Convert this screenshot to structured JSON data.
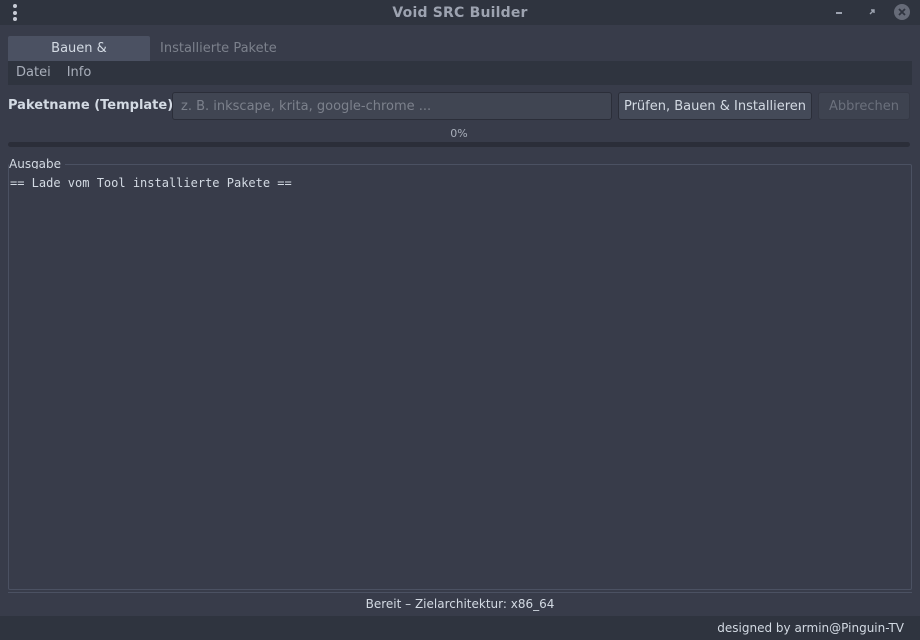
{
  "window": {
    "title": "Void SRC Builder"
  },
  "tabs": [
    {
      "label": "Bauen & Installieren",
      "active": true
    },
    {
      "label": "Installierte Pakete",
      "active": false
    }
  ],
  "menubar": {
    "file": "Datei",
    "info": "Info"
  },
  "form": {
    "label": "Paketname (Template):",
    "input_value": "",
    "input_placeholder": "z. B. inkscape, krita, google-chrome ...",
    "build_button": "Prüfen, Bauen & Installieren",
    "cancel_button": "Abbrechen"
  },
  "progress": {
    "label": "0%",
    "value": 0
  },
  "output": {
    "legend": "Ausgabe",
    "text": "== Lade vom Tool installierte Pakete =="
  },
  "status": {
    "text": "Bereit – Zielarchitektur: x86_64"
  },
  "footer": {
    "credit": "designed by armin@Pinguin-TV"
  },
  "colors": {
    "background": "#383c4a",
    "titlebar": "#2f343f",
    "text": "#d3dae3",
    "accent": "#5294e2"
  }
}
